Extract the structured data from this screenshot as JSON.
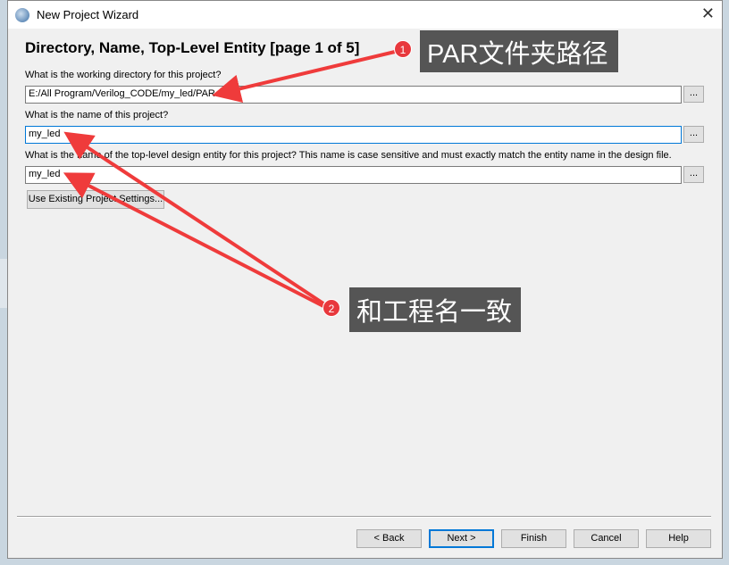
{
  "window": {
    "title": "New Project Wizard",
    "close_label": "✕"
  },
  "page": {
    "heading": "Directory, Name, Top-Level Entity [page 1 of 5]"
  },
  "fields": [
    {
      "label": "What is the working directory for this project?",
      "value": "E:/All Program/Verilog_CODE/my_led/PAR",
      "browse": "..."
    },
    {
      "label": "What is the name of this project?",
      "value": "my_led",
      "browse": "..."
    },
    {
      "label": "What is the name of the top-level design entity for this project? This name is case sensitive and must exactly match the entity name in the design file.",
      "value": "my_led",
      "browse": "..."
    }
  ],
  "use_existing_label": "Use Existing Project Settings...",
  "buttons": {
    "back": "< Back",
    "next": "Next >",
    "finish": "Finish",
    "cancel": "Cancel",
    "help": "Help"
  },
  "annotations": [
    {
      "number": "1",
      "text": "PAR文件夹路径"
    },
    {
      "number": "2",
      "text": "和工程名一致"
    }
  ],
  "colors": {
    "annotation_arrow": "#ef3b3b",
    "annotation_box": "#555555",
    "focus": "#0078d7"
  }
}
